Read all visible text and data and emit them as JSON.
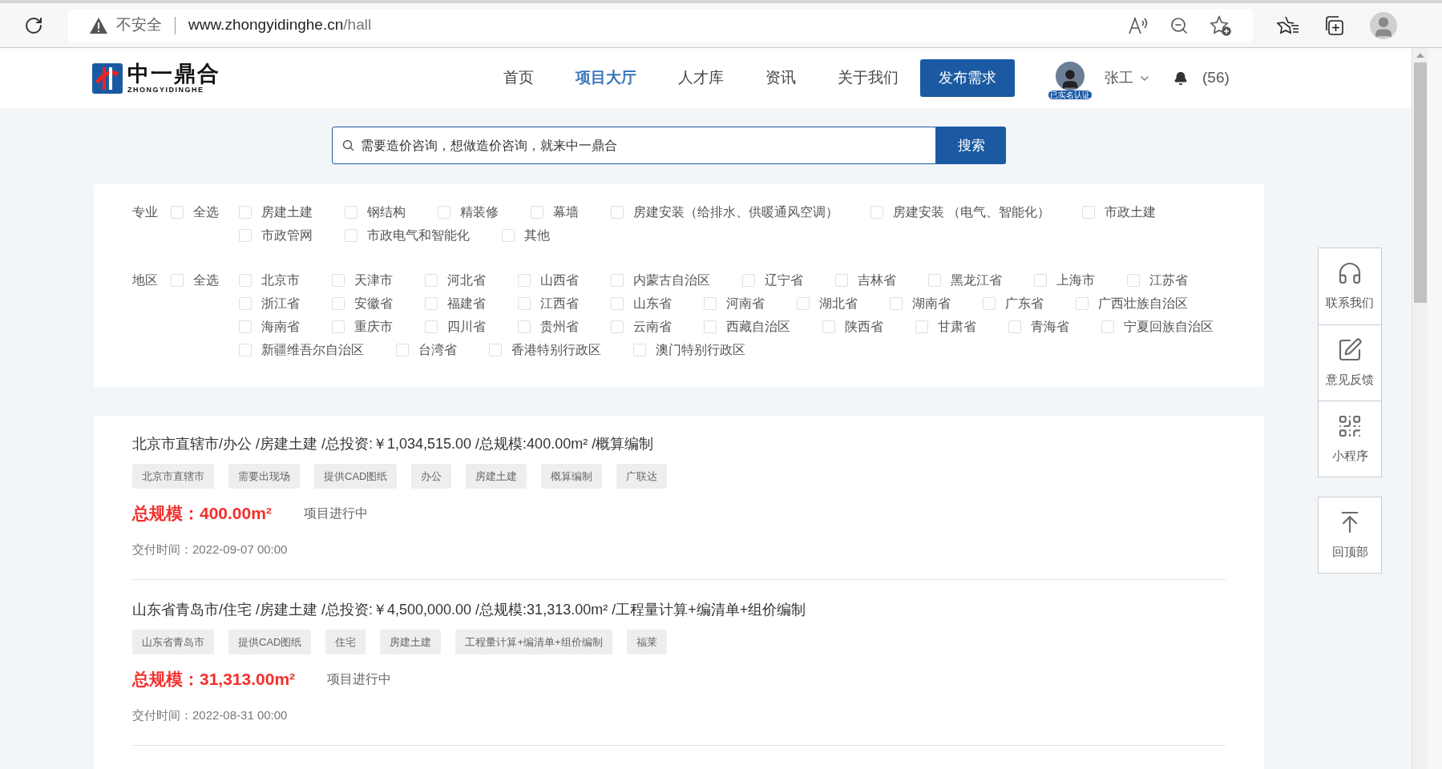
{
  "browser": {
    "security_label": "不安全",
    "url_host": "www.zhongyidinghe.cn",
    "url_path": "/hall"
  },
  "nav": {
    "logo_text": "中一鼎合",
    "logo_subtext": "ZHONGYIDINGHE",
    "items": [
      {
        "label": "首页",
        "selected": false
      },
      {
        "label": "项目大厅",
        "selected": true
      },
      {
        "label": "人才库",
        "selected": false
      },
      {
        "label": "资讯",
        "selected": false
      },
      {
        "label": "关于我们",
        "selected": false
      }
    ],
    "publish_button": "发布需求",
    "user": {
      "name": "张工",
      "badge": "已实名认证"
    },
    "notifications": "(56)"
  },
  "search": {
    "placeholder": "需要造价咨询，想做造价咨询，就来中一鼎合",
    "button": "搜索"
  },
  "filters": [
    {
      "label": "专业",
      "select_all": {
        "label": "全选",
        "checked": false
      },
      "options": [
        {
          "label": "房建土建",
          "checked": false
        },
        {
          "label": "钢结构",
          "checked": false
        },
        {
          "label": "精装修",
          "checked": false
        },
        {
          "label": "幕墙",
          "checked": false
        },
        {
          "label": "房建安装（给排水、供暖通风空调）",
          "checked": false
        },
        {
          "label": "房建安装 （电气、智能化）",
          "checked": false
        },
        {
          "label": "市政土建",
          "checked": false
        },
        {
          "label": "市政管网",
          "checked": false
        },
        {
          "label": "市政电气和智能化",
          "checked": false
        },
        {
          "label": "其他",
          "checked": false
        }
      ]
    },
    {
      "label": "地区",
      "select_all": {
        "label": "全选",
        "checked": false
      },
      "options": [
        {
          "label": "北京市",
          "checked": false
        },
        {
          "label": "天津市",
          "checked": false
        },
        {
          "label": "河北省",
          "checked": false
        },
        {
          "label": "山西省",
          "checked": false
        },
        {
          "label": "内蒙古自治区",
          "checked": false
        },
        {
          "label": "辽宁省",
          "checked": false
        },
        {
          "label": "吉林省",
          "checked": false
        },
        {
          "label": "黑龙江省",
          "checked": false
        },
        {
          "label": "上海市",
          "checked": false
        },
        {
          "label": "江苏省",
          "checked": false
        },
        {
          "label": "浙江省",
          "checked": false
        },
        {
          "label": "安徽省",
          "checked": false
        },
        {
          "label": "福建省",
          "checked": false
        },
        {
          "label": "江西省",
          "checked": false
        },
        {
          "label": "山东省",
          "checked": false
        },
        {
          "label": "河南省",
          "checked": false
        },
        {
          "label": "湖北省",
          "checked": false
        },
        {
          "label": "湖南省",
          "checked": false
        },
        {
          "label": "广东省",
          "checked": false
        },
        {
          "label": "广西壮族自治区",
          "checked": false
        },
        {
          "label": "海南省",
          "checked": false
        },
        {
          "label": "重庆市",
          "checked": false
        },
        {
          "label": "四川省",
          "checked": false
        },
        {
          "label": "贵州省",
          "checked": false
        },
        {
          "label": "云南省",
          "checked": false
        },
        {
          "label": "西藏自治区",
          "checked": false
        },
        {
          "label": "陕西省",
          "checked": false
        },
        {
          "label": "甘肃省",
          "checked": false
        },
        {
          "label": "青海省",
          "checked": false
        },
        {
          "label": "宁夏回族自治区",
          "checked": false
        },
        {
          "label": "新疆维吾尔自治区",
          "checked": false
        },
        {
          "label": "台湾省",
          "checked": false
        },
        {
          "label": "香港特别行政区",
          "checked": false
        },
        {
          "label": "澳门特别行政区",
          "checked": false
        }
      ]
    }
  ],
  "projects": [
    {
      "title": "北京市直辖市/办公 /房建土建 /总投资:￥1,034,515.00 /总规模:400.00m² /概算编制",
      "tags": [
        "北京市直辖市",
        "需要出现场",
        "提供CAD图纸",
        "办公",
        "房建土建",
        "概算编制",
        "广联达"
      ],
      "scale_label": "总规模：",
      "scale_value": "400.00m²",
      "status": "项目进行中",
      "delivery": "交付时间：2022-09-07 00:00"
    },
    {
      "title": "山东省青岛市/住宅 /房建土建 /总投资:￥4,500,000.00 /总规模:31,313.00m² /工程量计算+编清单+组价编制",
      "tags": [
        "山东省青岛市",
        "提供CAD图纸",
        "住宅",
        "房建土建",
        "工程量计算+编清单+组价编制",
        "福莱"
      ],
      "scale_label": "总规模：",
      "scale_value": "31,313.00m²",
      "status": "项目进行中",
      "delivery": "交付时间：2022-08-31 00:00"
    }
  ],
  "side_tools": [
    {
      "kind": "contact",
      "label": "联系我们"
    },
    {
      "kind": "feedback",
      "label": "意见反馈"
    },
    {
      "kind": "miniprogram",
      "label": "小程序"
    }
  ],
  "back_to_top": "回顶部"
}
